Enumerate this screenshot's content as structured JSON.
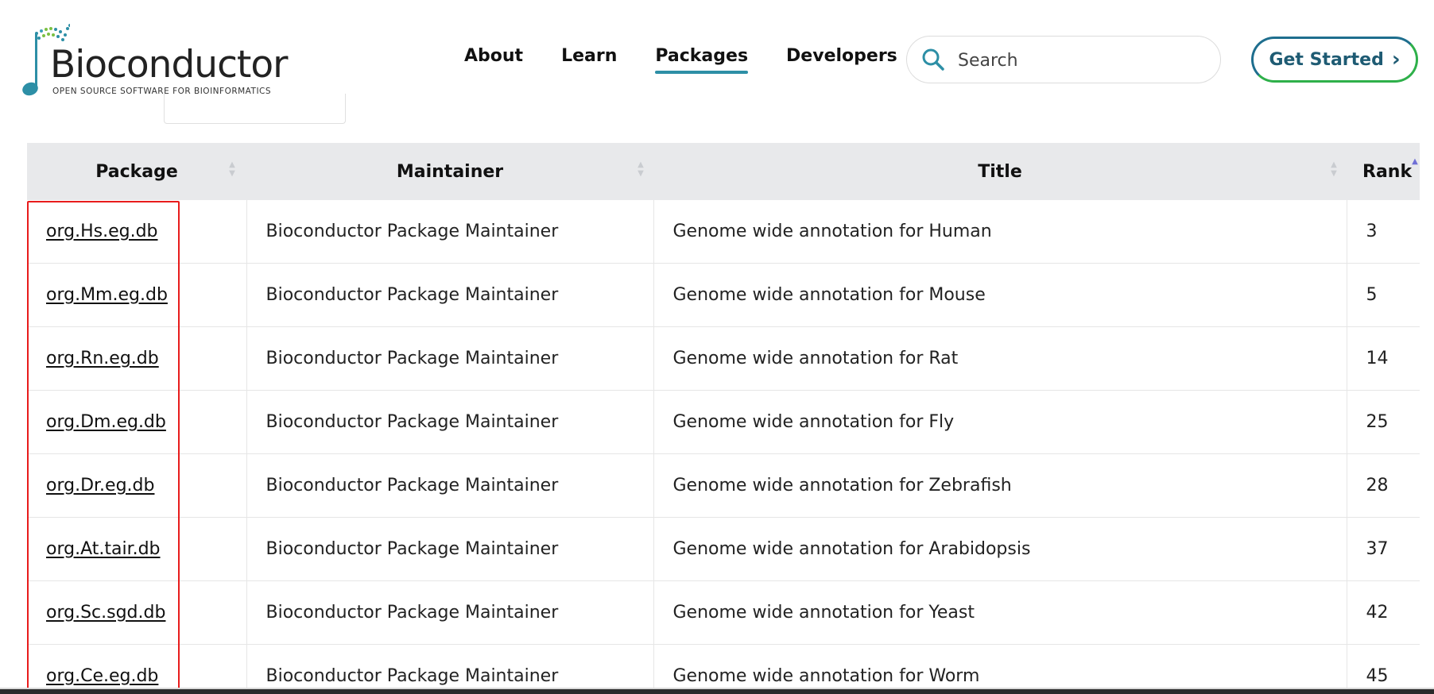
{
  "header": {
    "logo": {
      "word": "Bioconductor",
      "tagline": "OPEN SOURCE SOFTWARE FOR BIOINFORMATICS"
    },
    "nav": [
      {
        "label": "About",
        "active": false
      },
      {
        "label": "Learn",
        "active": false
      },
      {
        "label": "Packages",
        "active": true
      },
      {
        "label": "Developers",
        "active": false
      }
    ],
    "search": {
      "placeholder": "Search",
      "value": ""
    },
    "cta": {
      "label": "Get Started",
      "icon": "chevron-right-icon"
    }
  },
  "colors": {
    "accent": "#2d8fa6",
    "highlight": "#e81c1c",
    "cta_green": "#2eb04a",
    "cta_blue": "#1e6e8e"
  },
  "table": {
    "columns": [
      {
        "label": "Package",
        "sort": "none"
      },
      {
        "label": "Maintainer",
        "sort": "none"
      },
      {
        "label": "Title",
        "sort": "none"
      },
      {
        "label": "Rank",
        "sort": "ascending"
      }
    ],
    "rows": [
      {
        "package": "org.Hs.eg.db",
        "maintainer": "Bioconductor Package Maintainer",
        "title": "Genome wide annotation for Human",
        "rank": "3"
      },
      {
        "package": "org.Mm.eg.db",
        "maintainer": "Bioconductor Package Maintainer",
        "title": "Genome wide annotation for Mouse",
        "rank": "5"
      },
      {
        "package": "org.Rn.eg.db",
        "maintainer": "Bioconductor Package Maintainer",
        "title": "Genome wide annotation for Rat",
        "rank": "14"
      },
      {
        "package": "org.Dm.eg.db",
        "maintainer": "Bioconductor Package Maintainer",
        "title": "Genome wide annotation for Fly",
        "rank": "25"
      },
      {
        "package": "org.Dr.eg.db",
        "maintainer": "Bioconductor Package Maintainer",
        "title": "Genome wide annotation for Zebrafish",
        "rank": "28"
      },
      {
        "package": "org.At.tair.db",
        "maintainer": "Bioconductor Package Maintainer",
        "title": "Genome wide annotation for Arabidopsis",
        "rank": "37"
      },
      {
        "package": "org.Sc.sgd.db",
        "maintainer": "Bioconductor Package Maintainer",
        "title": "Genome wide annotation for Yeast",
        "rank": "42"
      },
      {
        "package": "org.Ce.eg.db",
        "maintainer": "Bioconductor Package Maintainer",
        "title": "Genome wide annotation for Worm",
        "rank": "45"
      }
    ]
  }
}
